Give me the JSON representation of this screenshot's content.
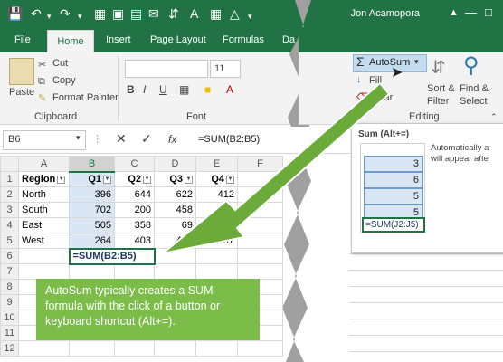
{
  "title_bar": {
    "user": "Jon Acamopora"
  },
  "tabs": [
    "File",
    "Home",
    "Insert",
    "Page Layout",
    "Formulas",
    "Da"
  ],
  "ribbon": {
    "paste": "Paste",
    "cut": "Cut",
    "copy": "Copy",
    "format_painter": "Format Painter",
    "clipboard_label": "Clipboard",
    "font_size": "11",
    "font_label": "Font",
    "bold": "B",
    "italic": "I",
    "underline": "U",
    "autosum": "AutoSum",
    "fill": "Fill",
    "clear": "Clear",
    "sort_filter_1": "Sort &",
    "sort_filter_2": "Filter",
    "find_select_1": "Find &",
    "find_select_2": "Select",
    "editing_label": "Editing"
  },
  "formula_bar": {
    "name_box": "B6",
    "formula": "=SUM(B2:B5)",
    "fx": "fx"
  },
  "sheet": {
    "columns": [
      "A",
      "B",
      "C",
      "D",
      "E",
      "F"
    ],
    "rows": [
      {
        "n": "1",
        "cells": [
          "Region",
          "Q1",
          "Q2",
          "Q3",
          "Q4",
          ""
        ]
      },
      {
        "n": "2",
        "cells": [
          "North",
          "396",
          "644",
          "622",
          "412",
          ""
        ]
      },
      {
        "n": "3",
        "cells": [
          "South",
          "702",
          "200",
          "458",
          "729",
          ""
        ]
      },
      {
        "n": "4",
        "cells": [
          "East",
          "505",
          "358",
          "69",
          "252",
          ""
        ]
      },
      {
        "n": "5",
        "cells": [
          "West",
          "264",
          "403",
          "469",
          "357",
          ""
        ]
      },
      {
        "n": "6",
        "cells": [
          "",
          "=SUM(B2:B5)",
          "",
          "",
          "",
          ""
        ]
      },
      {
        "n": "7",
        "cells": [
          "",
          "",
          "",
          "",
          "",
          ""
        ]
      },
      {
        "n": "8",
        "cells": [
          "",
          "",
          "",
          "",
          "",
          ""
        ]
      },
      {
        "n": "9",
        "cells": [
          "",
          "",
          "",
          "",
          "",
          ""
        ]
      },
      {
        "n": "10",
        "cells": [
          "",
          "",
          "",
          "",
          "",
          ""
        ]
      },
      {
        "n": "11",
        "cells": [
          "",
          "",
          "",
          "",
          "",
          ""
        ]
      },
      {
        "n": "12",
        "cells": [
          "",
          "",
          "",
          "",
          "",
          ""
        ]
      }
    ]
  },
  "tooltip": {
    "title": "Sum (Alt+=)",
    "desc1": "Automatically a",
    "desc2": "will appear afte",
    "mini_values": [
      "3",
      "6",
      "5",
      "5"
    ],
    "mini_formula": "=SUM(J2:J5)"
  },
  "callout": "AutoSum typically creates a SUM formula with the click of a button or keyboard shortcut (Alt+=).",
  "colors": {
    "excel_green": "#217346",
    "callout_green": "#7cbd4a",
    "selection_blue": "#dbe6f4"
  }
}
